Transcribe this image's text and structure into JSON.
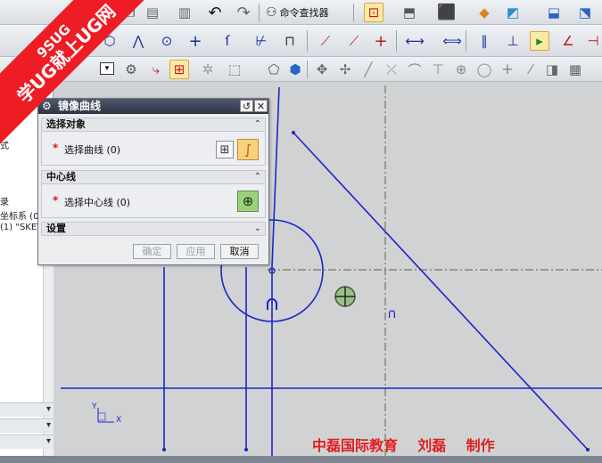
{
  "watermark": {
    "line1": "9SUG",
    "line2": "学UG就上UG网"
  },
  "toolbar": {
    "command_finder_label": "命令查找器",
    "row1_icons": [
      "undo-icon",
      "redo-icon",
      "command-finder-icon",
      "fit-view-icon",
      "shaded-view-icon",
      "cube-icon",
      "layer-icon",
      "assembly-icon"
    ],
    "row2_icons": [
      "sketch-circle-icon",
      "profile-icon",
      "circle-icon",
      "point-icon",
      "quick-trim-icon",
      "dimension-icon",
      "constraint-icon"
    ],
    "row3_icons": [
      "filter-dropdown-icon",
      "snap-point-icon",
      "move-icon",
      "line-icon",
      "arc-icon",
      "grid-icon"
    ]
  },
  "navigator": {
    "fragments": [
      "式",
      "录",
      "坐标系 (0",
      "(1) \"SKET"
    ]
  },
  "dialog": {
    "title": "镜像曲线",
    "groups": {
      "select_objects": "选择对象",
      "center_line": "中心线",
      "settings": "设置"
    },
    "select_curve_label": "选择曲线 (0)",
    "select_center_label": "选择中心线 (0)",
    "required_mark": "*",
    "buttons": {
      "ok": "确定",
      "apply": "应用",
      "cancel": "取消"
    },
    "reset_glyph": "↺",
    "close_glyph": "✕"
  },
  "canvas": {
    "caption": "中磊国际教育    刘磊    制作",
    "glyph": "∩",
    "axis_labels": {
      "x": "X",
      "y": "Y"
    },
    "colors": {
      "curve": "#1a26c9",
      "centerline": "#6f7a5a",
      "background": "#d1d2d3"
    }
  }
}
